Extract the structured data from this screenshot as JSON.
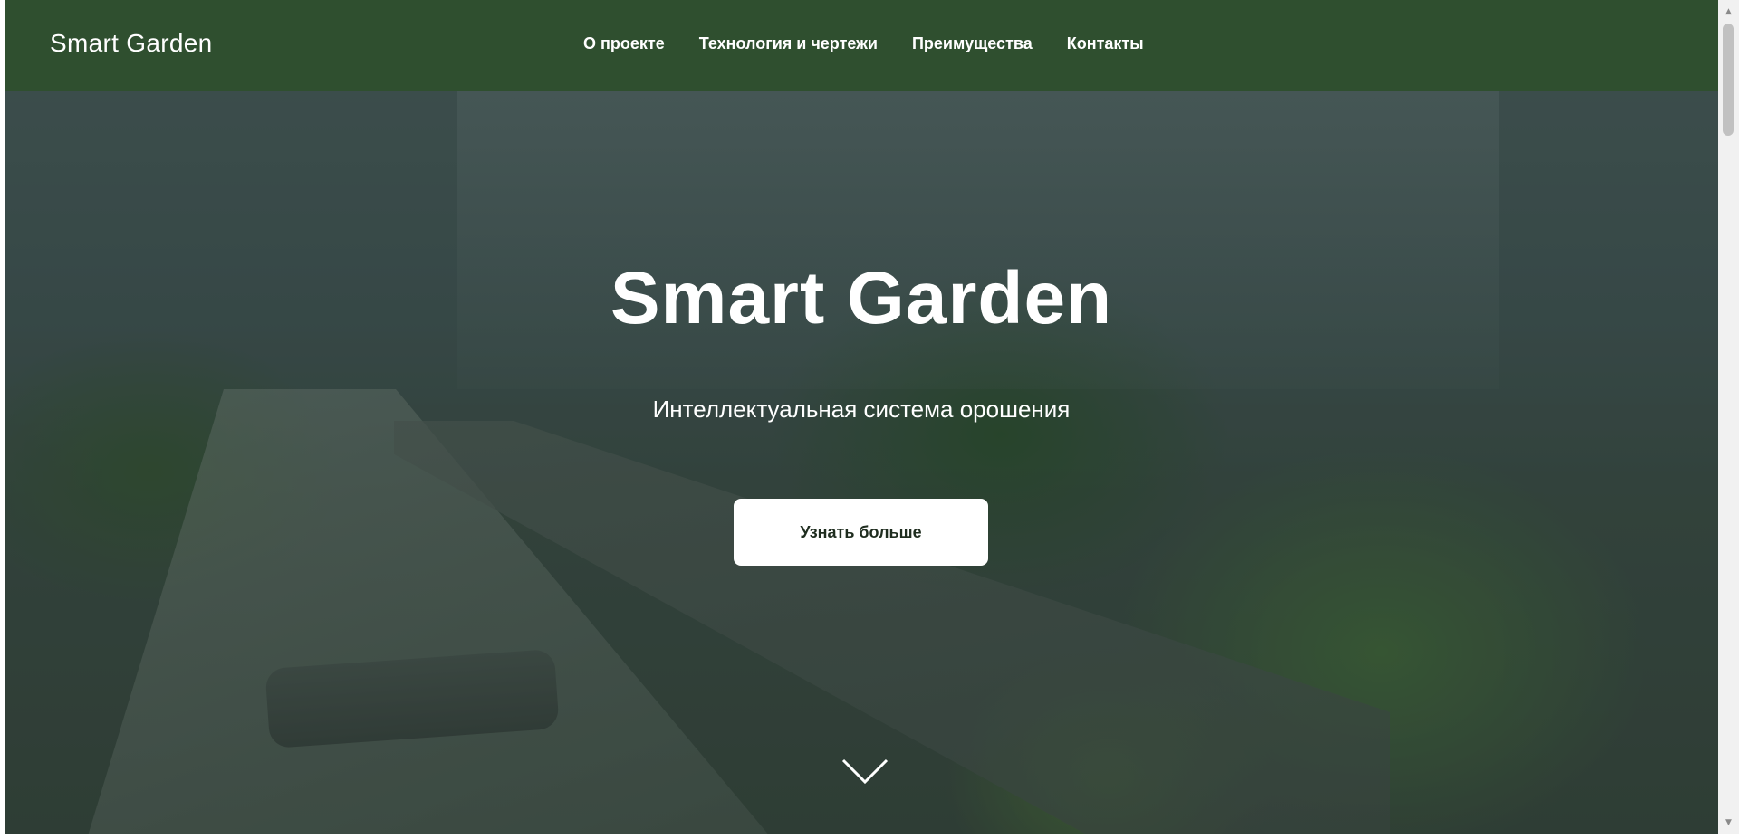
{
  "navbar": {
    "brand": "Smart Garden",
    "links": [
      {
        "label": "О проекте"
      },
      {
        "label": "Технология и чертежи"
      },
      {
        "label": "Преимущества"
      },
      {
        "label": "Контакты"
      }
    ],
    "background_color": "#2f4f2f"
  },
  "hero": {
    "title": "Smart Garden",
    "subtitle": "Интеллектуальная система орошения",
    "cta_label": "Узнать больше",
    "scroll_icon": "chevron-down-icon"
  },
  "scrollbar": {
    "up_icon": "scroll-up-arrow-icon",
    "down_icon": "scroll-down-arrow-icon"
  }
}
